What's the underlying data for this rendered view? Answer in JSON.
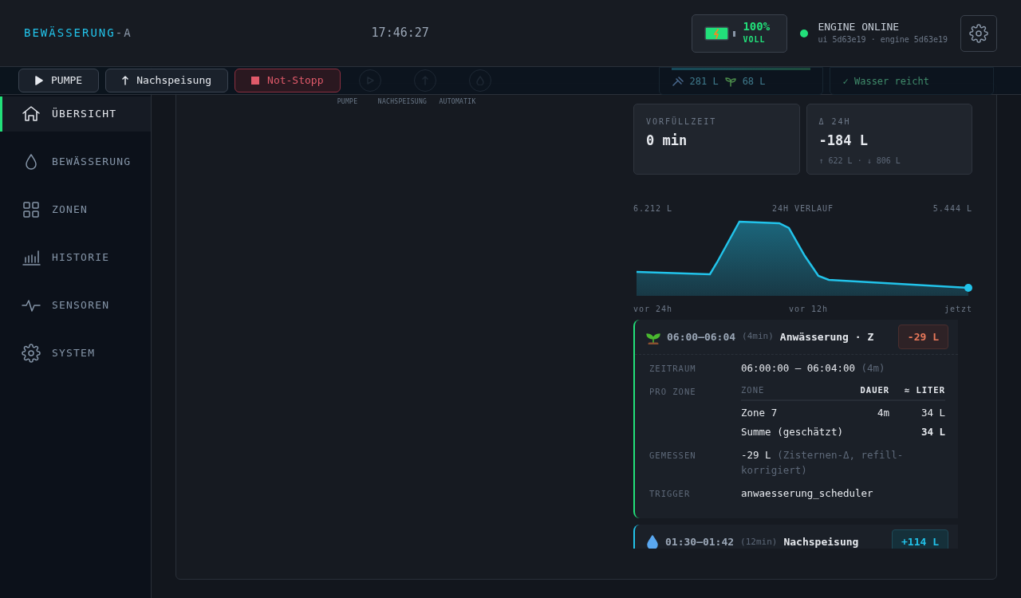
{
  "header": {
    "brand": "BEWÄSSERUNG",
    "brand_suffix": "-A",
    "clock": "17:46:27",
    "battery": {
      "percent": "100%",
      "state": "VOLL",
      "charging": true
    },
    "engine": {
      "status": "ENGINE ONLINE",
      "online": true,
      "versions": "ui 5d63e19 · engine 5d63e19"
    }
  },
  "actions": [
    {
      "kind": "play",
      "label": "PUMPE"
    },
    {
      "kind": "up",
      "label": "Nachspeisung"
    },
    {
      "kind": "stop",
      "label": "Not-Stopp"
    }
  ],
  "tank": {
    "drain": "281 L",
    "plants": "68 L",
    "verdict": "✓ Wasser reicht"
  },
  "sidebar": [
    {
      "kind": "home",
      "label": "ÜBERSICHT",
      "selected": true
    },
    {
      "kind": "drop",
      "label": "BEWÄSSERUNG",
      "selected": false
    },
    {
      "kind": "grid",
      "label": "ZONEN",
      "selected": false
    },
    {
      "kind": "bars",
      "label": "HISTORIE",
      "selected": false
    },
    {
      "kind": "pulse",
      "label": "SENSOREN",
      "selected": false
    },
    {
      "kind": "gear",
      "label": "SYSTEM",
      "selected": false
    }
  ],
  "controls": [
    {
      "kind": "pump",
      "label": "PUMPE"
    },
    {
      "kind": "refill",
      "label": "NACHSPEISUNG"
    },
    {
      "kind": "auto",
      "label": "AUTOMATIK"
    }
  ],
  "stats": [
    {
      "label": "VORFÜLLZEIT",
      "value": "0 min"
    },
    {
      "label": "Δ 24H",
      "value": "-184 L",
      "detail": "↑ 622 L · ↓ 806 L"
    }
  ],
  "history": {
    "left_value": "6.212 L",
    "title": "24H VERLAUF",
    "right_value": "5.444 L",
    "x_labels": [
      "vor 24h",
      "vor 12h",
      "jetzt"
    ]
  },
  "events": [
    {
      "kind": "watering",
      "time": "06:00–06:04",
      "duration": "(4min)",
      "title": "Anwässerung · Z",
      "delta": "-29 L",
      "expanded": true,
      "details": [
        {
          "kind": "text",
          "label": "ZEITRAUM",
          "value": "06:00:00 – 06:04:00",
          "note": "(4m)"
        },
        {
          "kind": "table",
          "label": "PRO ZONE",
          "columns": [
            "ZONE",
            "DAUER",
            "≈ LITER"
          ],
          "rows": [
            [
              "Zone 7",
              "4m",
              "34 L"
            ]
          ],
          "sum_label": "Summe (geschätzt)",
          "sum": "34 L"
        },
        {
          "kind": "text",
          "label": "GEMESSEN",
          "value": "-29 L",
          "note": "(Zisternen-Δ, refill-korrigiert)"
        },
        {
          "kind": "text",
          "label": "TRIGGER",
          "value": "anwaesserung_scheduler"
        }
      ]
    },
    {
      "kind": "refill",
      "time": "01:30–01:42",
      "duration": "(12min)",
      "title": "Nachspeisung",
      "delta": "+114 L",
      "expanded": false
    }
  ]
}
